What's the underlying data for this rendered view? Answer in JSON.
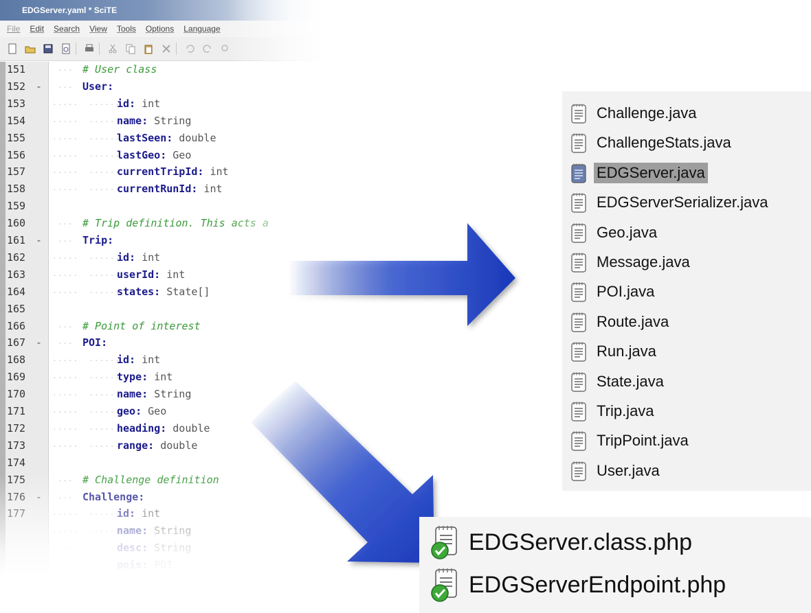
{
  "editor": {
    "title": "EDGServer.yaml * SciTE",
    "menu": [
      "File",
      "Edit",
      "Search",
      "View",
      "Tools",
      "Options",
      "Language"
    ],
    "toolbar_icons": [
      "new-icon",
      "open-icon",
      "save-icon",
      "revert-icon",
      "print-icon",
      "cut-icon",
      "copy-icon",
      "paste-icon",
      "delete-icon",
      "undo-icon",
      "redo-icon",
      "find-icon"
    ],
    "lines": [
      {
        "num": "151",
        "fold": "",
        "indent": 1,
        "comment": "# User class"
      },
      {
        "num": "152",
        "fold": "-",
        "indent": 1,
        "key": "User:"
      },
      {
        "num": "153",
        "fold": "",
        "indent": 2,
        "key": "id:",
        "value": " int"
      },
      {
        "num": "154",
        "fold": "",
        "indent": 2,
        "key": "name:",
        "value": " String"
      },
      {
        "num": "155",
        "fold": "",
        "indent": 2,
        "key": "lastSeen:",
        "value": " double"
      },
      {
        "num": "156",
        "fold": "",
        "indent": 2,
        "key": "lastGeo:",
        "value": " Geo"
      },
      {
        "num": "157",
        "fold": "",
        "indent": 2,
        "key": "currentTripId:",
        "value": " int"
      },
      {
        "num": "158",
        "fold": "",
        "indent": 2,
        "key": "currentRunId:",
        "value": " int"
      },
      {
        "num": "159",
        "fold": "",
        "indent": 0
      },
      {
        "num": "160",
        "fold": "",
        "indent": 1,
        "comment": "# Trip definition. This acts a"
      },
      {
        "num": "161",
        "fold": "-",
        "indent": 1,
        "key": "Trip:"
      },
      {
        "num": "162",
        "fold": "",
        "indent": 2,
        "key": "id:",
        "value": " int"
      },
      {
        "num": "163",
        "fold": "",
        "indent": 2,
        "key": "userId:",
        "value": " int"
      },
      {
        "num": "164",
        "fold": "",
        "indent": 2,
        "key": "states:",
        "value": " State[]"
      },
      {
        "num": "165",
        "fold": "",
        "indent": 0
      },
      {
        "num": "166",
        "fold": "",
        "indent": 1,
        "comment": "# Point of interest"
      },
      {
        "num": "167",
        "fold": "-",
        "indent": 1,
        "key": "POI:"
      },
      {
        "num": "168",
        "fold": "",
        "indent": 2,
        "key": "id:",
        "value": " int"
      },
      {
        "num": "169",
        "fold": "",
        "indent": 2,
        "key": "type:",
        "value": " int"
      },
      {
        "num": "170",
        "fold": "",
        "indent": 2,
        "key": "name:",
        "value": " String"
      },
      {
        "num": "171",
        "fold": "",
        "indent": 2,
        "key": "geo:",
        "value": " Geo"
      },
      {
        "num": "172",
        "fold": "",
        "indent": 2,
        "key": "heading:",
        "value": " double"
      },
      {
        "num": "173",
        "fold": "",
        "indent": 2,
        "key": "range:",
        "value": " double"
      },
      {
        "num": "174",
        "fold": "",
        "indent": 0
      },
      {
        "num": "175",
        "fold": "",
        "indent": 1,
        "comment": "# Challenge definition"
      },
      {
        "num": "176",
        "fold": "-",
        "indent": 1,
        "key": "Challenge:"
      },
      {
        "num": "177",
        "fold": "",
        "indent": 2,
        "key": "id:",
        "value": " int"
      },
      {
        "num": "",
        "fold": "",
        "indent": 2,
        "key": "name:",
        "value": " String"
      },
      {
        "num": "",
        "fold": "",
        "indent": 2,
        "key": "desc:",
        "value": " String"
      },
      {
        "num": "",
        "fold": "",
        "indent": 2,
        "key": "pois:",
        "value": " POI"
      }
    ]
  },
  "java_files": {
    "selected": "EDGServer.java",
    "items": [
      "Challenge.java",
      "ChallengeStats.java",
      "EDGServer.java",
      "EDGServerSerializer.java",
      "Geo.java",
      "Message.java",
      "POI.java",
      "Route.java",
      "Run.java",
      "State.java",
      "Trip.java",
      "TripPoint.java",
      "User.java"
    ]
  },
  "php_files": {
    "items": [
      "EDGServer.class.php",
      "EDGServerEndpoint.php"
    ]
  },
  "colors": {
    "arrow": "#1c3fbf",
    "comment": "#3a9a3a",
    "key": "#1a1a8c",
    "selection": "#9e9e9e"
  }
}
